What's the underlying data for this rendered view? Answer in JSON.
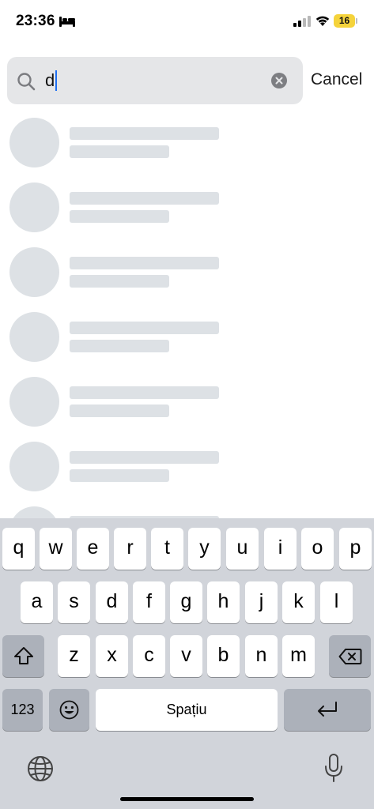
{
  "status_bar": {
    "time": "23:36",
    "battery_level": "16",
    "icons": [
      "bed-icon",
      "signal-icon",
      "wifi-icon",
      "battery-icon"
    ],
    "battery_color": "#f5d33b"
  },
  "search": {
    "query": "d",
    "cancel_label": "Cancel",
    "caret_color": "#1e6ff2"
  },
  "results": {
    "state": "loading",
    "skeleton_rows": 7
  },
  "keyboard": {
    "row1": [
      "q",
      "w",
      "e",
      "r",
      "t",
      "y",
      "u",
      "i",
      "o",
      "p"
    ],
    "row2": [
      "a",
      "s",
      "d",
      "f",
      "g",
      "h",
      "j",
      "k",
      "l"
    ],
    "row3": [
      "z",
      "x",
      "c",
      "v",
      "b",
      "n",
      "m"
    ],
    "numbers_label": "123",
    "space_label": "Spațiu",
    "icons": [
      "shift-icon",
      "backspace-icon",
      "emoji-icon",
      "return-icon",
      "globe-icon",
      "microphone-icon"
    ]
  }
}
